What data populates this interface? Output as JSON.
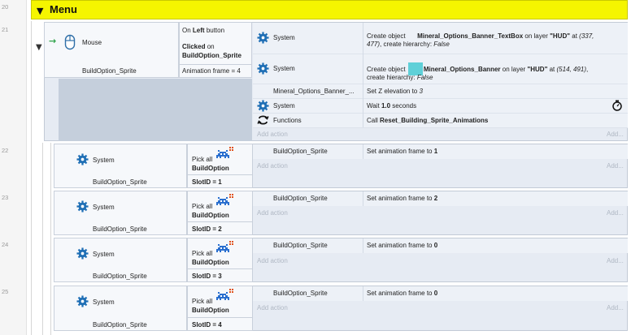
{
  "line_numbers": [
    "20",
    "21",
    "22",
    "23",
    "24",
    "25"
  ],
  "group": {
    "title": "Menu"
  },
  "event21": {
    "mouse_label": "Mouse",
    "object": "BuildOption_Sprite",
    "trigger_prefix": "On",
    "trigger_button": "Left",
    "trigger_suffix": "button",
    "clicked_prefix": "Clicked",
    "clicked_on": "on",
    "clicked_object": "BuildOption_Sprite",
    "anim_condition": "Animation frame = 4",
    "actions": [
      {
        "object": "System",
        "p1": "Create object",
        "obj": "Mineral_Options_Banner_TextBox",
        "p2": "on layer",
        "layer": "\"HUD\"",
        "p3": "at",
        "coords": "(337,",
        "line2_coords": "477)",
        "line2_text": ", create hierarchy:",
        "line2_value": "False"
      },
      {
        "object": "System",
        "p1": "Create object",
        "obj": "Mineral_Options_Banner",
        "p2": "on layer",
        "layer": "\"HUD\"",
        "p3": "at",
        "coords": "(514, 491)",
        "line2_text": "create hierarchy:",
        "line2_value": "False"
      },
      {
        "object": "Mineral_Options_Banner_...",
        "text": "Set Z elevation to",
        "value": "3"
      },
      {
        "object": "System",
        "text": "Wait",
        "value": "1.0",
        "suffix": "seconds"
      },
      {
        "object": "Functions",
        "text": "Call",
        "value": "Reset_Building_Sprite_Animations"
      }
    ],
    "add_action": "Add action",
    "add": "Add..."
  },
  "sub_events": [
    {
      "system": "System",
      "object": "BuildOption_Sprite",
      "pick_prefix": "Pick all",
      "pick_object": "BuildOption",
      "slot_condition": "SlotID = 1",
      "action_object": "BuildOption_Sprite",
      "action_text": "Set animation frame to",
      "action_value": "1",
      "add_action": "Add action",
      "add": "Add..."
    },
    {
      "system": "System",
      "object": "BuildOption_Sprite",
      "pick_prefix": "Pick all",
      "pick_object": "BuildOption",
      "slot_condition": "SlotID = 2",
      "action_object": "BuildOption_Sprite",
      "action_text": "Set animation frame to",
      "action_value": "2",
      "add_action": "Add action",
      "add": "Add..."
    },
    {
      "system": "System",
      "object": "BuildOption_Sprite",
      "pick_prefix": "Pick all",
      "pick_object": "BuildOption",
      "slot_condition": "SlotID = 3",
      "action_object": "BuildOption_Sprite",
      "action_text": "Set animation frame to",
      "action_value": "0",
      "add_action": "Add action",
      "add": "Add..."
    },
    {
      "system": "System",
      "object": "BuildOption_Sprite",
      "pick_prefix": "Pick all",
      "pick_object": "BuildOption",
      "slot_condition": "SlotID = 4",
      "action_object": "BuildOption_Sprite",
      "action_text": "Set animation frame to",
      "action_value": "0",
      "add_action": "Add action",
      "add": "Add..."
    }
  ],
  "colors": {
    "group_bar": "#f5f500",
    "event_bg": "#e6ebf3",
    "system_gear": "#1f6fb5",
    "banner_swatch": "#5fd0d8",
    "invader": "#2a6fcf"
  }
}
